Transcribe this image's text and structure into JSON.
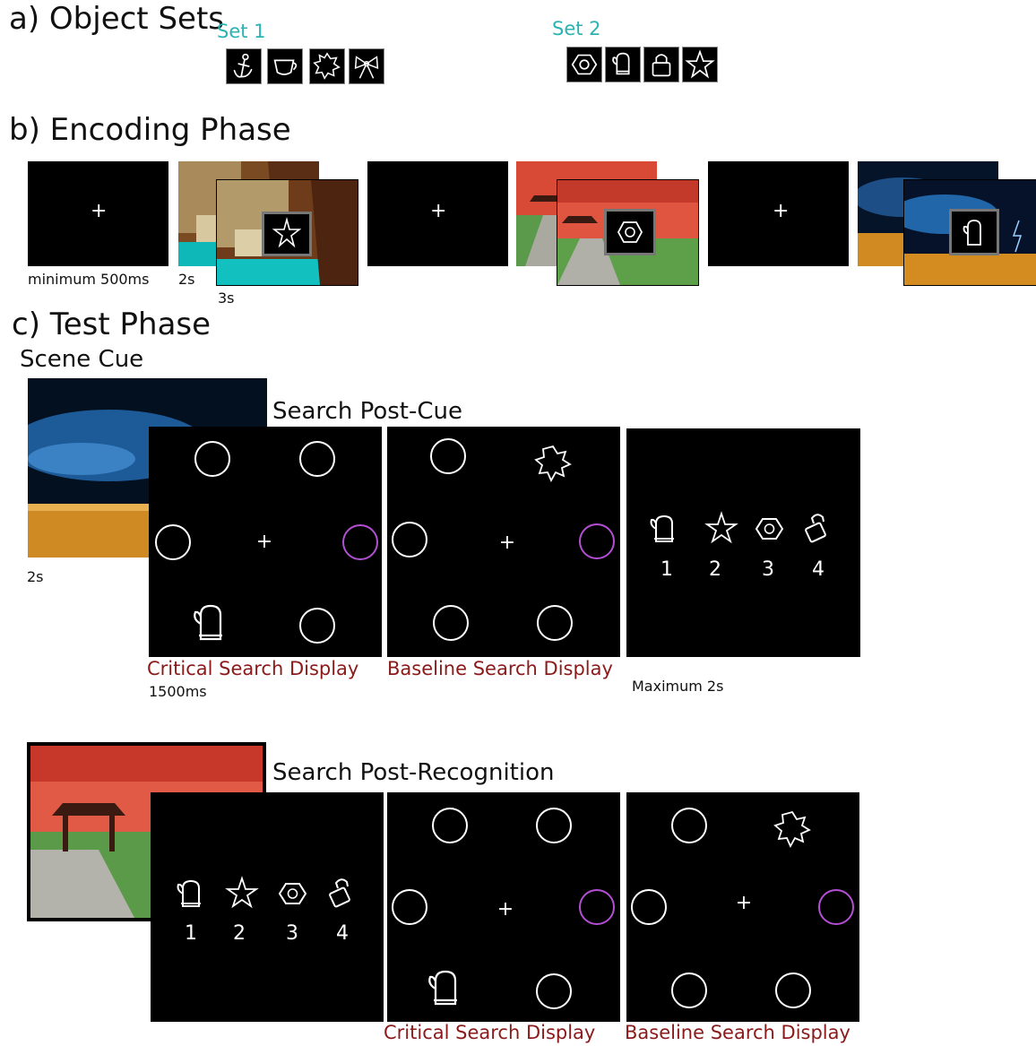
{
  "sections": {
    "a_title": "a) Object Sets",
    "b_title": "b) Encoding Phase",
    "c_title": "c) Test Phase"
  },
  "object_sets": {
    "set1_label": "Set 1",
    "set1_icons": [
      "anchor-icon",
      "cup-icon",
      "leaf-icon",
      "bow-icon"
    ],
    "set2_label": "Set 2",
    "set2_icons": [
      "nut-icon",
      "mitten-icon",
      "padlock-icon",
      "star-icon"
    ]
  },
  "encoding": {
    "fixation_symbol": "+",
    "timing_fixation": "minimum 500ms",
    "timing_scene": "2s",
    "timing_object": "3s"
  },
  "test": {
    "scene_cue_label": "Scene Cue",
    "scene_cue_time": "2s",
    "post_cue_label": "Search Post-Cue",
    "post_recognition_label": "Search Post-Recognition",
    "critical_label": "Critical Search Display",
    "baseline_label": "Baseline Search Display",
    "critical_time": "1500ms",
    "recognition_time": "Maximum 2s",
    "choice_numbers": [
      "1",
      "2",
      "3",
      "4"
    ],
    "target_ring_color": "#b24fd3"
  }
}
